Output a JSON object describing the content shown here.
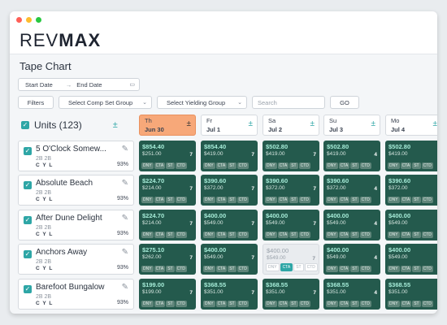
{
  "colors": {
    "teal": "#2ea6a6",
    "cell": "#245a4d",
    "today": "#f7a879"
  },
  "window": {
    "dots": [
      "#ff5f57",
      "#febc2e",
      "#28c840"
    ]
  },
  "logo": {
    "rev": "REV",
    "max": "MAX"
  },
  "page_title": "Tape Chart",
  "filters": {
    "start_date": "Start Date",
    "arrow": "→",
    "end_date": "End Date",
    "filters_button": "Filters",
    "comp_set": "Select Comp Set Group",
    "yielding": "Select Yielding Group",
    "search_placeholder": "Search",
    "go_button": "GO"
  },
  "units_header": {
    "label": "Units (123)",
    "plus": "±"
  },
  "days": [
    {
      "dow": "Th",
      "date": "Jun 30",
      "plus": "±",
      "today": true
    },
    {
      "dow": "Fr",
      "date": "Jul 1",
      "plus": "±"
    },
    {
      "dow": "Sa",
      "date": "Jul 2",
      "plus": "±"
    },
    {
      "dow": "Su",
      "date": "Jul 3",
      "plus": "±"
    },
    {
      "dow": "Mo",
      "date": "Jul 4",
      "plus": "±"
    }
  ],
  "tag_labels": [
    "DNY",
    "CTA",
    "ST",
    "CTD"
  ],
  "units": [
    {
      "name": "5 O'Clock Somew...",
      "beds": "2B 2B",
      "cyl": "C Y L",
      "occ": "93%",
      "cells": [
        {
          "p1": "$854.40",
          "p2": "$251.00",
          "n": "7"
        },
        {
          "p1": "$854.40",
          "p2": "$419.00",
          "n": "7"
        },
        {
          "p1": "$502.80",
          "p2": "$419.00",
          "n": "7"
        },
        {
          "p1": "$502.80",
          "p2": "$419.00",
          "n": "4"
        },
        {
          "p1": "$502.80",
          "p2": "$419.00",
          "n": ""
        }
      ]
    },
    {
      "name": "Absolute Beach",
      "beds": "2B 2B",
      "cyl": "C Y L",
      "occ": "93%",
      "cells": [
        {
          "p1": "$224.70",
          "p2": "$214.00",
          "n": "7"
        },
        {
          "p1": "$390.60",
          "p2": "$372.00",
          "n": "7"
        },
        {
          "p1": "$390.60",
          "p2": "$372.00",
          "n": "7"
        },
        {
          "p1": "$390.60",
          "p2": "$372.00",
          "n": "4"
        },
        {
          "p1": "$390.60",
          "p2": "$372.00",
          "n": ""
        }
      ]
    },
    {
      "name": "After Dune Delight",
      "beds": "2B 2B",
      "cyl": "C Y L",
      "occ": "93%",
      "cells": [
        {
          "p1": "$224.70",
          "p2": "$214.00",
          "n": "7"
        },
        {
          "p1": "$400.00",
          "p2": "$549.00",
          "n": "7"
        },
        {
          "p1": "$400.00",
          "p2": "$549.00",
          "n": "7"
        },
        {
          "p1": "$400.00",
          "p2": "$549.00",
          "n": "4"
        },
        {
          "p1": "$400.00",
          "p2": "$549.00",
          "n": ""
        }
      ]
    },
    {
      "name": "Anchors Away",
      "beds": "2B 2B",
      "cyl": "C Y L",
      "occ": "93%",
      "cells": [
        {
          "p1": "$275.10",
          "p2": "$262.00",
          "n": "7"
        },
        {
          "p1": "$400.00",
          "p2": "$549.00",
          "n": "7"
        },
        {
          "p1": "$400.00",
          "p2": "$549.00",
          "n": "7",
          "grey": true
        },
        {
          "p1": "$400.00",
          "p2": "$549.00",
          "n": "4"
        },
        {
          "p1": "$400.00",
          "p2": "$549.00",
          "n": ""
        }
      ]
    },
    {
      "name": "Barefoot Bungalow",
      "beds": "2B 2B",
      "cyl": "C Y L",
      "occ": "93%",
      "cells": [
        {
          "p1": "$199.00",
          "p2": "$199.00",
          "n": "7"
        },
        {
          "p1": "$368.55",
          "p2": "$351.00",
          "n": "7"
        },
        {
          "p1": "$368.55",
          "p2": "$351.00",
          "n": "7"
        },
        {
          "p1": "$368.55",
          "p2": "$351.00",
          "n": "4"
        },
        {
          "p1": "$368.55",
          "p2": "$351.00",
          "n": ""
        }
      ]
    }
  ]
}
